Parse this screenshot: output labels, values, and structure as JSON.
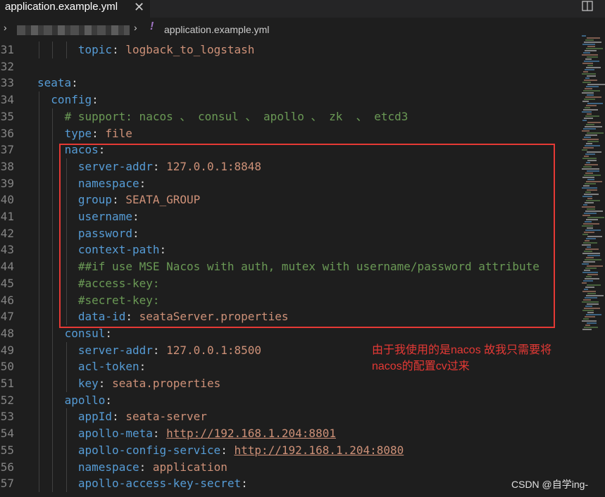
{
  "tab": {
    "title": "application.example.yml",
    "close_glyph": "✕"
  },
  "breadcrumb": {
    "separator": "›",
    "yaml_glyph": "!",
    "file": "application.example.yml"
  },
  "note": {
    "line1": "由于我使用的是nacos 故我只需要将",
    "line2": "nacos的配置cv过来"
  },
  "watermark": "CSDN @自学ing-",
  "lines": [
    {
      "num": "31",
      "indent": 6,
      "key": "topic",
      "value": "logback_to_logstash"
    },
    {
      "num": "32"
    },
    {
      "num": "33",
      "indent": 0,
      "key": "seata",
      "value": ""
    },
    {
      "num": "34",
      "indent": 2,
      "key": "config",
      "value": ""
    },
    {
      "num": "35",
      "indent": 4,
      "comment": "# support: nacos 、 consul 、 apollo 、 zk  、 etcd3"
    },
    {
      "num": "36",
      "indent": 4,
      "key": "type",
      "value": "file"
    },
    {
      "num": "37",
      "indent": 4,
      "key": "nacos",
      "value": ""
    },
    {
      "num": "38",
      "indent": 6,
      "key": "server-addr",
      "value": "127.0.0.1:8848"
    },
    {
      "num": "39",
      "indent": 6,
      "key": "namespace",
      "value": ""
    },
    {
      "num": "40",
      "indent": 6,
      "key": "group",
      "value": "SEATA_GROUP"
    },
    {
      "num": "41",
      "indent": 6,
      "key": "username",
      "value": ""
    },
    {
      "num": "42",
      "indent": 6,
      "key": "password",
      "value": ""
    },
    {
      "num": "43",
      "indent": 6,
      "key": "context-path",
      "value": ""
    },
    {
      "num": "44",
      "indent": 6,
      "comment": "##if use MSE Nacos with auth, mutex with username/password attribute"
    },
    {
      "num": "45",
      "indent": 6,
      "comment": "#access-key:"
    },
    {
      "num": "46",
      "indent": 6,
      "comment": "#secret-key:"
    },
    {
      "num": "47",
      "indent": 6,
      "key": "data-id",
      "value": "seataServer.properties"
    },
    {
      "num": "48",
      "indent": 4,
      "key": "consul",
      "value": ""
    },
    {
      "num": "49",
      "indent": 6,
      "key": "server-addr",
      "value": "127.0.0.1:8500"
    },
    {
      "num": "50",
      "indent": 6,
      "key": "acl-token",
      "value": ""
    },
    {
      "num": "51",
      "indent": 6,
      "key": "key",
      "value": "seata.properties"
    },
    {
      "num": "52",
      "indent": 4,
      "key": "apollo",
      "value": ""
    },
    {
      "num": "53",
      "indent": 6,
      "key": "appId",
      "value": "seata-server"
    },
    {
      "num": "54",
      "indent": 6,
      "key": "apollo-meta",
      "value": "http://192.168.1.204:8801",
      "link": true
    },
    {
      "num": "55",
      "indent": 6,
      "key": "apollo-config-service",
      "value": "http://192.168.1.204:8080",
      "link": true
    },
    {
      "num": "56",
      "indent": 6,
      "key": "namespace",
      "value": "application"
    },
    {
      "num": "57",
      "indent": 6,
      "key": "apollo-access-key-secret",
      "value": ""
    }
  ],
  "colors": {
    "key": "#569cd6",
    "value": "#ce9178",
    "comment": "#6a9955",
    "highlight_box": "#e53935",
    "background": "#1e1e1e"
  }
}
